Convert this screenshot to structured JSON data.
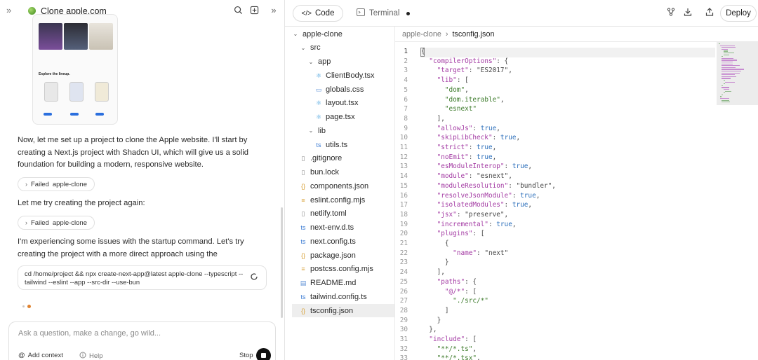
{
  "chat": {
    "title": "Clone apple.com",
    "messages": [
      "Now, let me set up a project to clone the Apple website. I'll start by creating a Next.js project with Shadcn UI, which will give us a solid foundation for building a modern, responsive website.",
      "Let me try creating the project again:",
      "I'm experiencing some issues with the startup command. Let's try creating the project with a more direct approach using the"
    ],
    "failed_label": "Failed",
    "failed_target": "apple-clone",
    "command": "cd /home/project && npx create-next-app@latest apple-clone --typescript --tailwind --eslint --app --src-dir --use-bun",
    "preview": {
      "explore_label": "Explore the lineup."
    },
    "input": {
      "placeholder": "Ask a question, make a change, go wild...",
      "add_context": "Add context",
      "help": "Help",
      "stop": "Stop"
    }
  },
  "ide": {
    "tabs": {
      "code": "Code",
      "terminal": "Terminal"
    },
    "deploy": "Deploy",
    "breadcrumb": {
      "root": "apple-clone",
      "file": "tsconfig.json"
    },
    "tree": [
      {
        "name": "apple-clone",
        "type": "folder",
        "depth": 0,
        "open": true
      },
      {
        "name": "src",
        "type": "folder",
        "depth": 1,
        "open": true
      },
      {
        "name": "app",
        "type": "folder",
        "depth": 2,
        "open": true
      },
      {
        "name": "ClientBody.tsx",
        "type": "react",
        "depth": 3
      },
      {
        "name": "globals.css",
        "type": "css",
        "depth": 3
      },
      {
        "name": "layout.tsx",
        "type": "react",
        "depth": 3
      },
      {
        "name": "page.tsx",
        "type": "react",
        "depth": 3
      },
      {
        "name": "lib",
        "type": "folder",
        "depth": 2,
        "open": true
      },
      {
        "name": "utils.ts",
        "type": "ts",
        "depth": 3
      },
      {
        "name": ".gitignore",
        "type": "file",
        "depth": 1
      },
      {
        "name": "bun.lock",
        "type": "file",
        "depth": 1
      },
      {
        "name": "components.json",
        "type": "json",
        "depth": 1
      },
      {
        "name": "eslint.config.mjs",
        "type": "js",
        "depth": 1
      },
      {
        "name": "netlify.toml",
        "type": "file",
        "depth": 1
      },
      {
        "name": "next-env.d.ts",
        "type": "ts",
        "depth": 1
      },
      {
        "name": "next.config.ts",
        "type": "ts",
        "depth": 1
      },
      {
        "name": "package.json",
        "type": "json",
        "depth": 1
      },
      {
        "name": "postcss.config.mjs",
        "type": "js",
        "depth": 1
      },
      {
        "name": "README.md",
        "type": "md",
        "depth": 1
      },
      {
        "name": "tailwind.config.ts",
        "type": "ts",
        "depth": 1
      },
      {
        "name": "tsconfig.json",
        "type": "json",
        "depth": 1,
        "selected": true
      }
    ],
    "code_lines": [
      "{",
      "  \"compilerOptions\": {",
      "    \"target\": \"ES2017\",",
      "    \"lib\": [",
      "      \"dom\",",
      "      \"dom.iterable\",",
      "      \"esnext\"",
      "    ],",
      "    \"allowJs\": true,",
      "    \"skipLibCheck\": true,",
      "    \"strict\": true,",
      "    \"noEmit\": true,",
      "    \"esModuleInterop\": true,",
      "    \"module\": \"esnext\",",
      "    \"moduleResolution\": \"bundler\",",
      "    \"resolveJsonModule\": true,",
      "    \"isolatedModules\": true,",
      "    \"jsx\": \"preserve\",",
      "    \"incremental\": true,",
      "    \"plugins\": [",
      "      {",
      "        \"name\": \"next\"",
      "      }",
      "    ],",
      "    \"paths\": {",
      "      \"@/*\": [",
      "        \"./src/*\"",
      "      ]",
      "    }",
      "  },",
      "  \"include\": [",
      "    \"**/*.ts\",",
      "    \"**/*.tsx\","
    ]
  }
}
